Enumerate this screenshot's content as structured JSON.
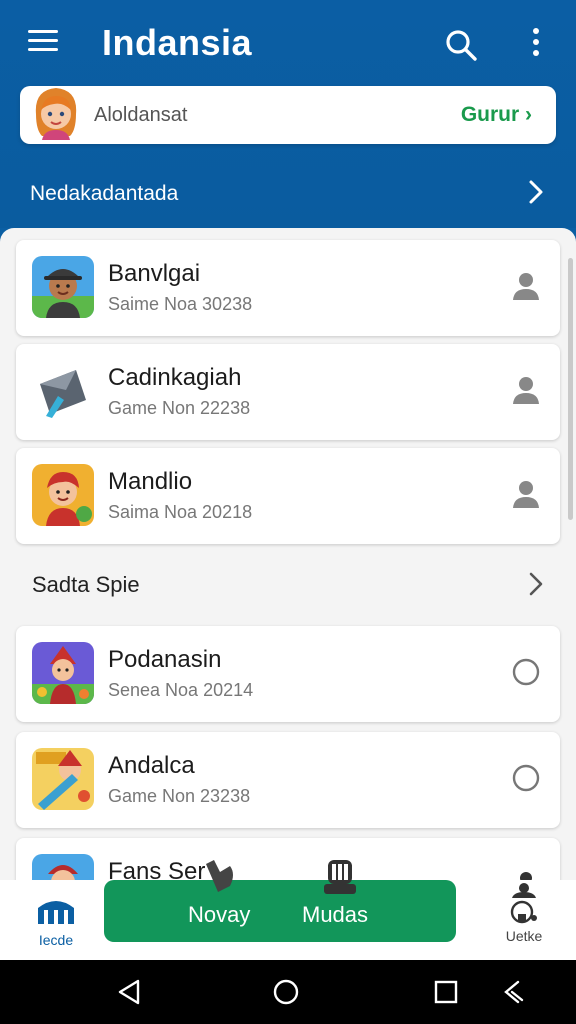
{
  "header": {
    "title": "Indansia",
    "menu_icon": "hamburger-menu-icon",
    "search_icon": "search-icon",
    "more_icon": "more-vertical-icon"
  },
  "banner": {
    "text": "Aloldansat",
    "cta": "Gurur ›"
  },
  "section_top": {
    "label": "Nedakadantada"
  },
  "games": [
    {
      "title": "Banvlgai",
      "subtitle": "Saime Noa 30238",
      "action": "person-icon"
    },
    {
      "title": "Cadinkagiah",
      "subtitle": "Game Non 22238",
      "action": "person-icon"
    },
    {
      "title": "Mandlio",
      "subtitle": "Saima Noa 20218",
      "action": "person-icon"
    }
  ],
  "section_mid": {
    "label": "Sadta Spie"
  },
  "games2": [
    {
      "title": "Podanasin",
      "subtitle": "Senea Noa 20214",
      "action": "radio-circle-icon"
    },
    {
      "title": "Andalca",
      "subtitle": "Game Non 23238",
      "action": "radio-circle-icon"
    },
    {
      "title": "Fans Ser",
      "subtitle": "",
      "action": "person-icon"
    }
  ],
  "bottom_nav": {
    "home_label": "Iecde",
    "pill_left": "Novay",
    "pill_right": "Mudas",
    "profile_label": "Uetke"
  },
  "colors": {
    "primary": "#0b5fa3",
    "accent_green": "#12965a",
    "cta_green": "#1a9a4c"
  }
}
